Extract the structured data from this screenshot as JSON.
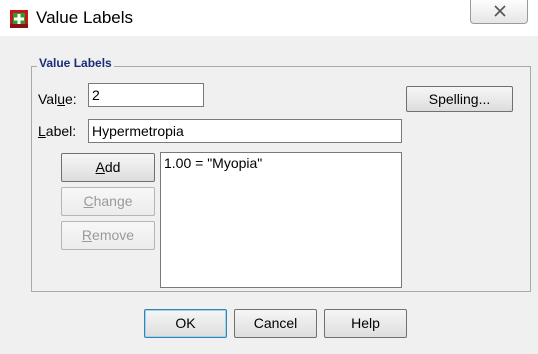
{
  "window": {
    "title": "Value Labels",
    "close_symbol": "X"
  },
  "group": {
    "legend": "Value Labels"
  },
  "value_field": {
    "label_pre": "Val",
    "label_mnemonic": "u",
    "label_post": "e:",
    "value": "2"
  },
  "label_field": {
    "label_mnemonic": "L",
    "label_post": "abel:",
    "value": "Hypermetropia"
  },
  "buttons": {
    "spelling": "Spelling...",
    "add_mnemonic": "A",
    "add_rest": "dd",
    "change_mnemonic": "C",
    "change_rest": "hange",
    "remove_mnemonic": "R",
    "remove_rest": "emove",
    "ok": "OK",
    "cancel": "Cancel",
    "help": "Help"
  },
  "value_list": {
    "items": [
      "1.00 = \"Myopia\""
    ]
  },
  "colors": {
    "legend_text": "#1a2d7a",
    "icon_red": "#c4161c",
    "icon_green": "#2a9d2a"
  },
  "icons": {
    "app": "spss-app-icon",
    "close": "close-icon"
  }
}
